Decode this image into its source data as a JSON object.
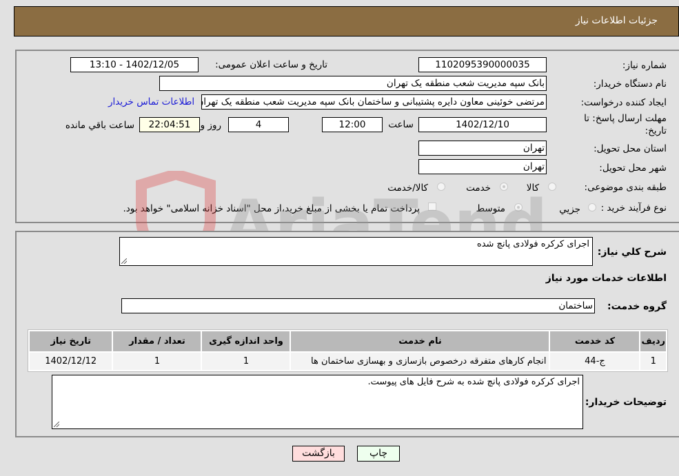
{
  "header": {
    "title": "جزئیات اطلاعات نیاز"
  },
  "form": {
    "need_number": {
      "label": "شماره نیاز:",
      "value": "1102095390000035"
    },
    "announce_datetime": {
      "label": "تاریخ و ساعت اعلان عمومی:",
      "value": "1402/12/05 - 13:10"
    },
    "buyer_org": {
      "label": "نام دستگاه خریدار:",
      "value": "بانک سپه مدیریت شعب منطقه یک تهران"
    },
    "requester": {
      "label": "ایجاد کننده درخواست:",
      "value": "مرتضی  خوئینی معاون دایره پشتیبانی و ساختمان بانک سپه مدیریت شعب منطقه یک تهران",
      "contact_link": "اطلاعات تماس خریدار"
    },
    "deadline": {
      "label_line1": "مهلت ارسال پاسخ: تا",
      "label_line2": "تاریخ:",
      "date": "1402/12/10",
      "time_label": "ساعت",
      "time": "12:00",
      "days": "4",
      "days_label": "روز و",
      "remaining": "22:04:51",
      "remaining_label": "ساعت باقي مانده"
    },
    "province": {
      "label": "استان محل تحویل:",
      "value": "تهران"
    },
    "city": {
      "label": "شهر محل تحویل:",
      "value": "تهران"
    },
    "category": {
      "label": "طبقه بندی موضوعی:",
      "options": [
        "کالا",
        "خدمت",
        "کالا/خدمت"
      ],
      "selected": "خدمت"
    },
    "purchase_type": {
      "label": "نوع فرآیند خرید :",
      "options": [
        "جزیي",
        "متوسط"
      ],
      "selected": "متوسط",
      "treasury_note": "پرداخت تمام یا بخشی از مبلغ خرید،از محل \"اسناد خزانه اسلامی\" خواهد بود."
    }
  },
  "details": {
    "summary_label": "شرح کلي نیاز:",
    "summary_value": "اجرای کرکره فولادی پانچ شده",
    "services_heading": "اطلاعات خدمات مورد نیاز",
    "service_group_label": "گروه خدمت:",
    "service_group_value": "ساختمان",
    "table": {
      "headers": [
        "ردیف",
        "کد خدمت",
        "نام خدمت",
        "واحد اندازه گیری",
        "تعداد / مقدار",
        "تاریخ نیاز"
      ],
      "rows": [
        [
          "1",
          "ج-44",
          "انجام کارهای متفرقه درخصوص بازسازی و بهسازی ساختمان ها",
          "1",
          "1",
          "1402/12/12"
        ]
      ]
    },
    "buyer_notes_label": "توضیحات خریدار:",
    "buyer_notes_value": "اجرای کرکره فولادی پانچ شده به شرح فایل های پیوست."
  },
  "buttons": {
    "print": "چاپ",
    "back": "بازگشت"
  },
  "watermark": {
    "text": "AriaTender.neT"
  },
  "colors": {
    "header_bg": "#8b6d42",
    "print_bg": "#eeffee",
    "back_bg": "#ffdddd",
    "link": "#1a1ad6"
  }
}
